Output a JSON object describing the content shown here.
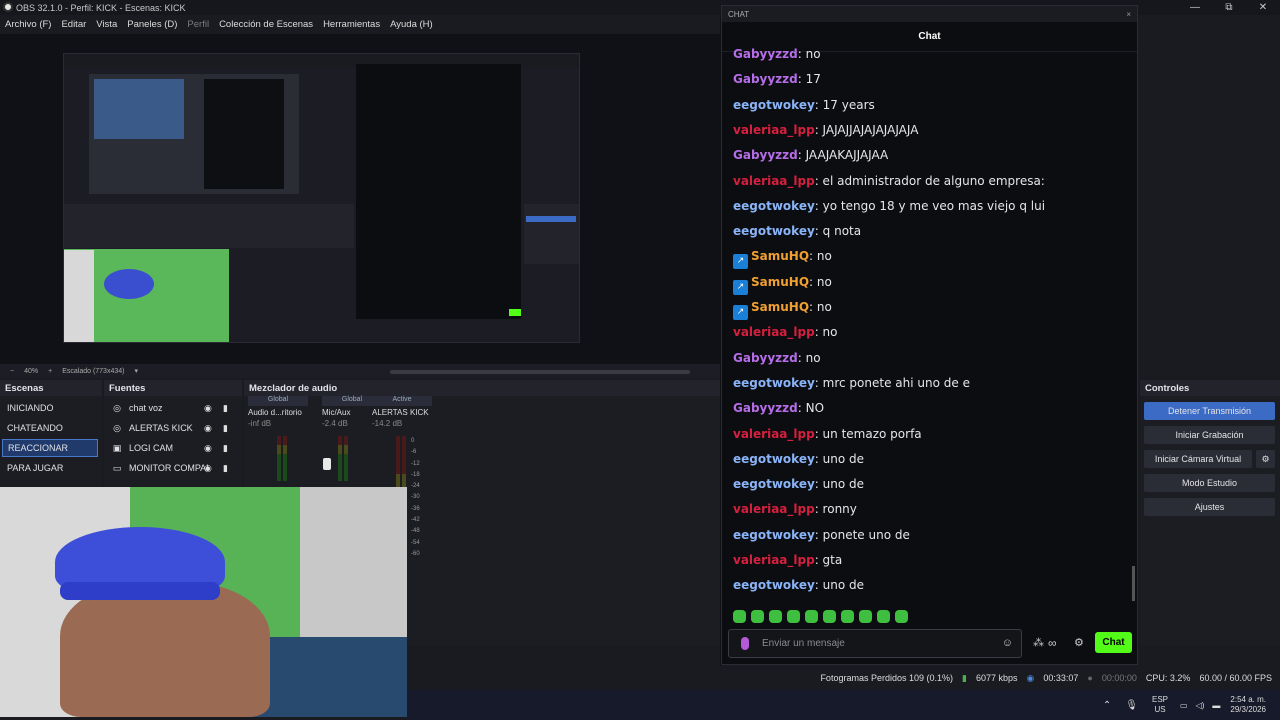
{
  "window": {
    "title": "OBS 32.1.0 - Perfil: KICK - Escenas: KICK",
    "min": "—",
    "max": "⧉",
    "close": "✕"
  },
  "menu": [
    "Archivo (F)",
    "Editar",
    "Vista",
    "Paneles (D)",
    "Perfil",
    "Colección de Escenas",
    "Herramientas",
    "Ayuda (H)"
  ],
  "zoom": {
    "minus": "−",
    "value": "40%",
    "plus": "+",
    "scale_label": "Escalado (773x434)"
  },
  "scenes": {
    "title": "Escenas",
    "items": [
      "INICIANDO",
      "CHATEANDO",
      "REACCIONAR",
      "PARA JUGAR"
    ],
    "selected": "REACCIONAR"
  },
  "sources": {
    "title": "Fuentes",
    "items": [
      {
        "label": "chat voz",
        "icon": "globe-icon"
      },
      {
        "label": "ALERTAS KICK",
        "icon": "globe-icon"
      },
      {
        "label": "LOGI CAM",
        "icon": "camera-icon"
      },
      {
        "label": "MONITOR COMPAI",
        "icon": "monitor-icon"
      }
    ]
  },
  "mixer": {
    "title": "Mezclador de audio",
    "channels": [
      {
        "cat": "Global",
        "name": "Audio d...ritorio",
        "db": "-inf dB"
      },
      {
        "cat": "Global",
        "name": "Mic/Aux",
        "db": "-2.4 dB"
      },
      {
        "cat": "Active",
        "name": "ALERTAS KICK",
        "db": "-14.2 dB"
      }
    ],
    "scale": [
      "0",
      "-6",
      "-12",
      "-18",
      "-24",
      "-30",
      "-36",
      "-42",
      "-48",
      "-54",
      "-60"
    ]
  },
  "chat": {
    "window_label": "CHAT",
    "title": "Chat",
    "messages": [
      {
        "user": "Gabyyzzd",
        "text": ": no",
        "color": "#b66ee8",
        "badge": false
      },
      {
        "user": "Gabyyzzd",
        "text": ": 17",
        "color": "#b66ee8",
        "badge": false
      },
      {
        "user": "eegotwokey",
        "text": ": 17 years",
        "color": "#8ab4f8",
        "badge": false
      },
      {
        "user": "valeriaa_lpp",
        "text": ": JAJAJJAJAJAJAJAJA",
        "color": "#d6203f",
        "badge": false
      },
      {
        "user": "Gabyyzzd",
        "text": ": JAAJAKAJJAJAA",
        "color": "#b66ee8",
        "badge": false
      },
      {
        "user": "valeriaa_lpp",
        "text": ": el administrador de alguno empresa:",
        "color": "#d6203f",
        "badge": false
      },
      {
        "user": "eegotwokey",
        "text": ": yo tengo 18 y me veo mas viejo q lui",
        "color": "#8ab4f8",
        "badge": false
      },
      {
        "user": "eegotwokey",
        "text": ": q nota",
        "color": "#8ab4f8",
        "badge": false
      },
      {
        "user": "SamuHQ",
        "text": ": no",
        "color": "#f0a030",
        "badge": true
      },
      {
        "user": "SamuHQ",
        "text": ": no",
        "color": "#f0a030",
        "badge": true
      },
      {
        "user": "SamuHQ",
        "text": ": no",
        "color": "#f0a030",
        "badge": true
      },
      {
        "user": "valeriaa_lpp",
        "text": ": no",
        "color": "#d6203f",
        "badge": false
      },
      {
        "user": "Gabyyzzd",
        "text": ": no",
        "color": "#b66ee8",
        "badge": false
      },
      {
        "user": "eegotwokey",
        "text": ": mrc ponete ahi uno de e",
        "color": "#8ab4f8",
        "badge": false
      },
      {
        "user": "Gabyyzzd",
        "text": ": NO",
        "color": "#b66ee8",
        "badge": false
      },
      {
        "user": "valeriaa_lpp",
        "text": ": un temazo porfa",
        "color": "#d6203f",
        "badge": false
      },
      {
        "user": "eegotwokey",
        "text": ": uno de",
        "color": "#8ab4f8",
        "badge": false
      },
      {
        "user": "eegotwokey",
        "text": ": uno de",
        "color": "#8ab4f8",
        "badge": false
      },
      {
        "user": "valeriaa_lpp",
        "text": ": ronny",
        "color": "#d6203f",
        "badge": false
      },
      {
        "user": "eegotwokey",
        "text": ": ponete uno de",
        "color": "#8ab4f8",
        "badge": false
      },
      {
        "user": "valeriaa_lpp",
        "text": ": gta",
        "color": "#d6203f",
        "badge": false
      },
      {
        "user": "eegotwokey",
        "text": ": uno de",
        "color": "#8ab4f8",
        "badge": false
      }
    ],
    "input_placeholder": "Enviar un mensaje",
    "send_label": "Chat"
  },
  "controls": {
    "title": "Controles",
    "buttons": [
      "Detener Transmisión",
      "Iniciar Grabación",
      "Iniciar Cámara Virtual",
      "Modo Estudio",
      "Ajustes"
    ]
  },
  "status": {
    "dropped": "Fotogramas Perdidos 109 (0.1%)",
    "kbps": "6077 kbps",
    "stream_time": "00:33:07",
    "rec_time": "00:00:00",
    "cpu": "CPU: 3.2%",
    "fps": "60.00 / 60.00 FPS"
  },
  "taskbar": {
    "lang1": "ESP",
    "lang2": "US",
    "time": "2:54 a. m.",
    "date": "29/3/2026"
  }
}
